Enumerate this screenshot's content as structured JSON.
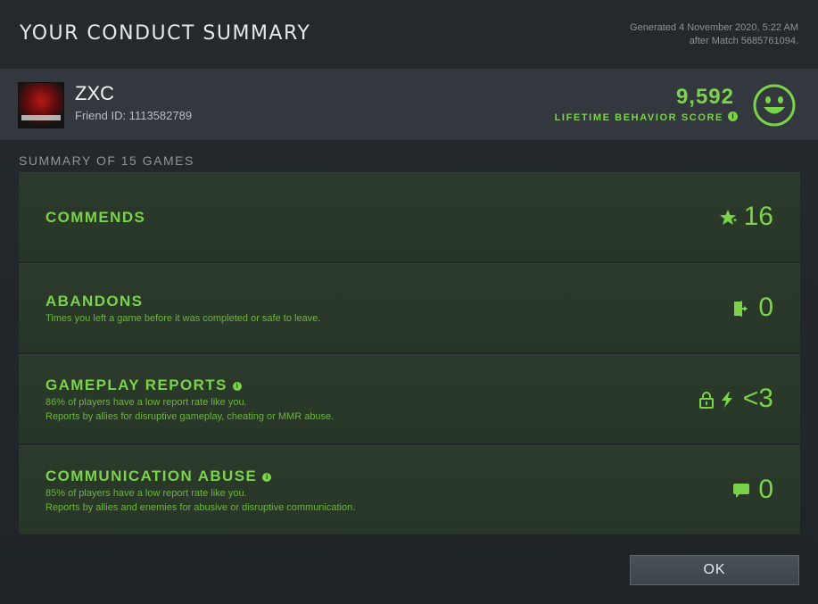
{
  "header": {
    "title": "YOUR CONDUCT SUMMARY",
    "generated_line1": "Generated 4 November 2020, 5:22 AM",
    "generated_line2": "after Match 5685761094."
  },
  "profile": {
    "name": "ZXC",
    "friend_id": "Friend ID: 1113582789",
    "score": "9,592",
    "score_label": "LIFETIME BEHAVIOR SCORE",
    "score_icon": "smiley-face-icon",
    "accent_color": "#7bd34a"
  },
  "summary": {
    "label": "SUMMARY OF 15 GAMES",
    "cards": [
      {
        "title": "COMMENDS",
        "value": "16",
        "icon": "star-plus-icon"
      },
      {
        "title": "ABANDONS",
        "desc1": "Times you left a game before it was completed or safe to leave.",
        "value": "0",
        "icon": "exit-door-icon"
      },
      {
        "title": "GAMEPLAY REPORTS",
        "desc1": "86% of players have a low report rate like you.",
        "desc2": "Reports by allies for disruptive gameplay, cheating or MMR abuse.",
        "value": "<3",
        "icon": "lock-lightning-icon"
      },
      {
        "title": "COMMUNICATION ABUSE",
        "desc1": "85% of players have a low report rate like you.",
        "desc2": "Reports by allies and enemies for abusive or disruptive communication.",
        "value": "0",
        "icon": "chat-bubble-icon"
      }
    ]
  },
  "ok_label": "OK"
}
